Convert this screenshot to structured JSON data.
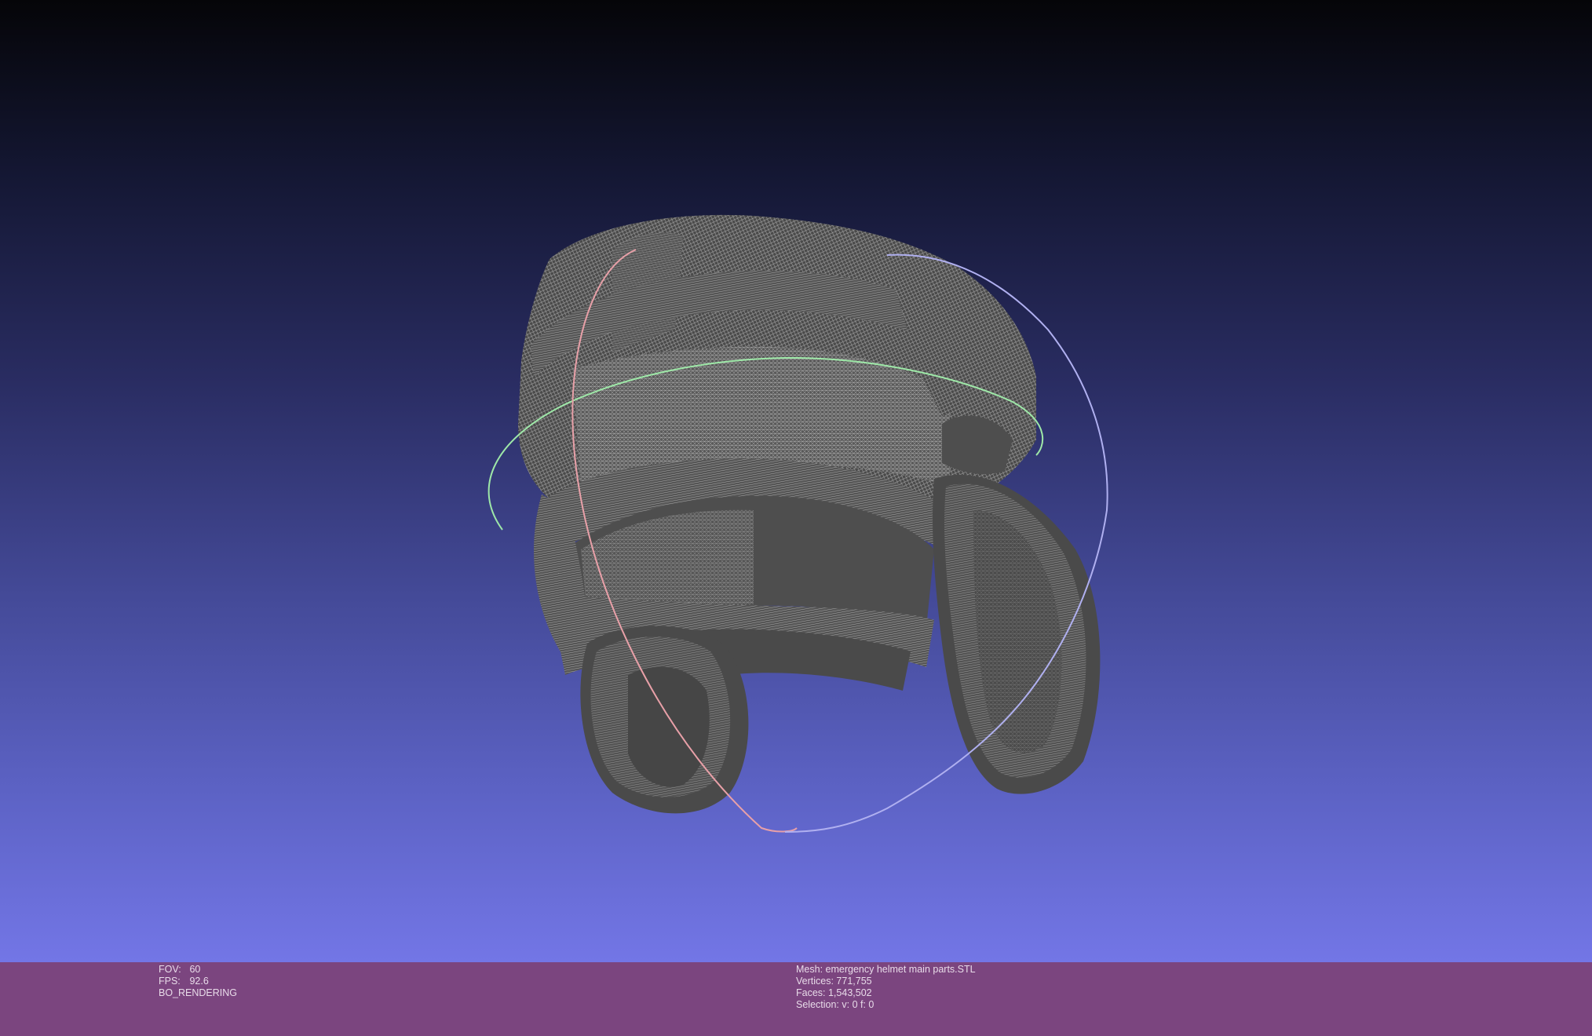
{
  "app": {
    "viewer": "MeshLab 3D viewport"
  },
  "viewport": {
    "background_top": "#050508",
    "background_bottom": "#7376e6",
    "mesh_color": "#4a4a4a",
    "wire_color": "#d9d9d9",
    "trackball_colors": {
      "x_ring": "#e8a0a8",
      "y_ring": "#9ee8a8",
      "z_ring": "#b0b0f0"
    }
  },
  "status_bar": {
    "background": "#7b457f",
    "left": {
      "fov_label": "FOV:",
      "fov_value": "60",
      "fps_label": "FPS:",
      "fps_value": "92.6",
      "render_mode": "BO_RENDERING"
    },
    "right": {
      "mesh": "Mesh: emergency helmet main parts.STL",
      "vertices": "Vertices: 771,755",
      "faces": "Faces: 1,543,502",
      "selection": "Selection: v: 0 f: 0"
    }
  }
}
